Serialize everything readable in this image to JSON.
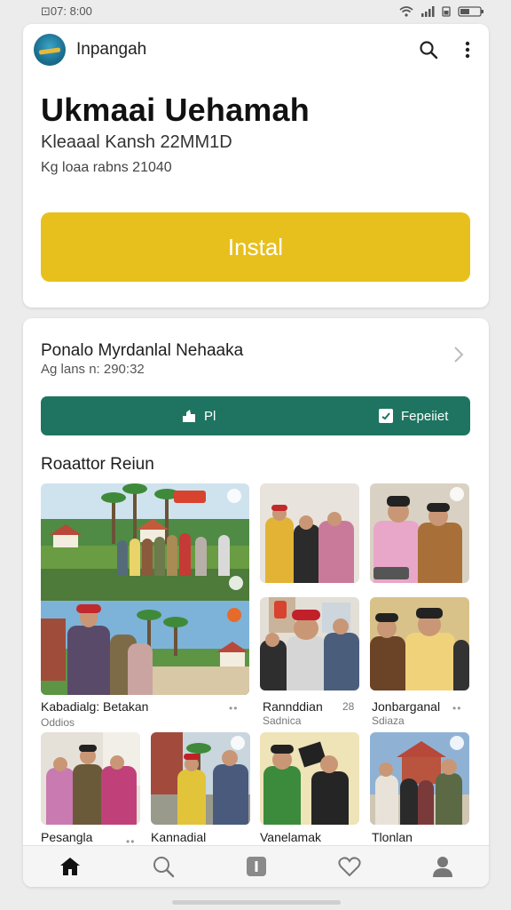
{
  "status": {
    "time": "⊡07: 8:00"
  },
  "app": {
    "name": "Inpangah"
  },
  "hero": {
    "title": "Ukmaai Uehamah",
    "subtitle": "Kleaaal Kansh 22MM1D",
    "meta": "Kg loaa rabns 21040",
    "install_label": "Instal"
  },
  "section": {
    "title": "Ponalo Myrdanlal Nehaaka",
    "subtitle": "Ag lans n: 290:32",
    "left_action": "Pl",
    "right_action": "Fepeiiet"
  },
  "gallery": {
    "title": "Roaattor Reiun",
    "items": [
      {
        "caption": "Kabadialg: Betakan",
        "sub": "Oddios",
        "meta": ""
      },
      {
        "caption": "Rannddian",
        "sub": "Sadnica",
        "meta": "28"
      },
      {
        "caption": "Jonbarganal",
        "sub": "Sdiaza",
        "meta": ""
      },
      {
        "caption": "Pesangla",
        "sub": "",
        "meta": ""
      },
      {
        "caption": "Kannadial",
        "sub": "",
        "meta": ""
      },
      {
        "caption": "Vanelamak",
        "sub": "",
        "meta": ""
      },
      {
        "caption": "Tlonlan",
        "sub": "",
        "meta": ""
      }
    ]
  },
  "colors": {
    "install": "#e8c01e",
    "green_bar": "#1e7460"
  },
  "icons": {
    "search": "search-icon",
    "more": "more-vertical-icon",
    "home": "home-icon",
    "explore": "search-icon",
    "library": "library-icon",
    "favorites": "heart-icon",
    "profile": "profile-icon"
  }
}
